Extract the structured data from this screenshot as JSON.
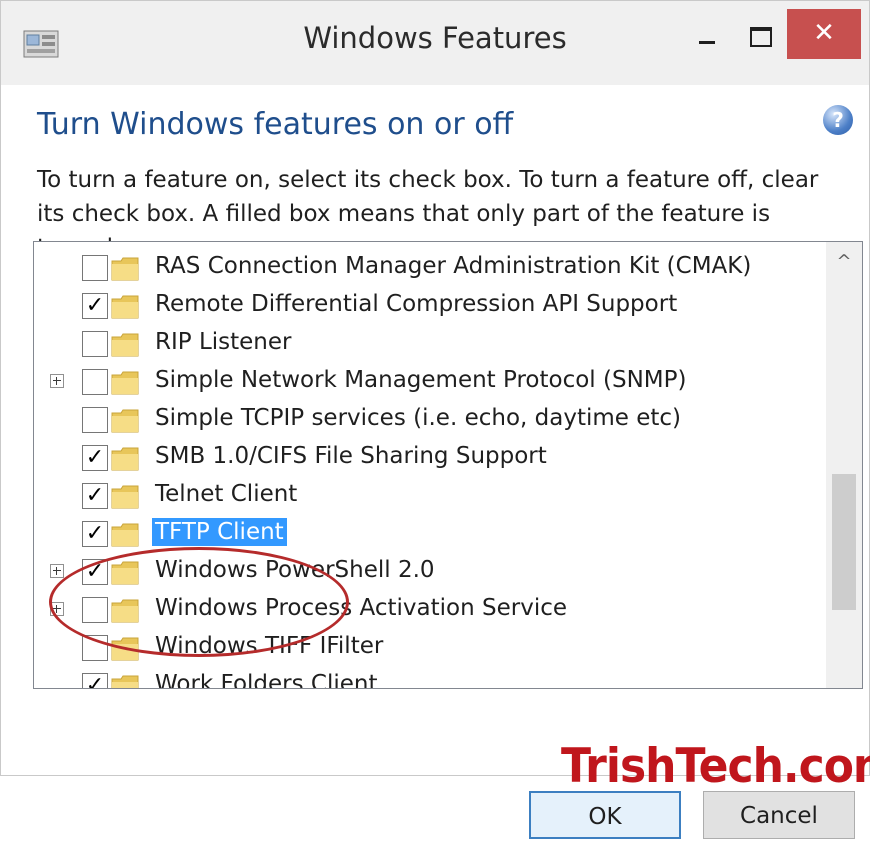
{
  "window": {
    "title": "Windows Features",
    "close_glyph": "✕"
  },
  "header": {
    "heading": "Turn Windows features on or off",
    "help_glyph": "?",
    "description": "To turn a feature on, select its check box. To turn a feature off, clear its check box. A filled box means that only part of the feature is turned on."
  },
  "features": [
    {
      "label": "RAS Connection Manager Administration Kit (CMAK)",
      "checked": false,
      "expandable": false,
      "selected": false
    },
    {
      "label": "Remote Differential Compression API Support",
      "checked": true,
      "expandable": false,
      "selected": false
    },
    {
      "label": "RIP Listener",
      "checked": false,
      "expandable": false,
      "selected": false
    },
    {
      "label": "Simple Network Management Protocol (SNMP)",
      "checked": false,
      "expandable": true,
      "selected": false
    },
    {
      "label": "Simple TCPIP services (i.e. echo, daytime etc)",
      "checked": false,
      "expandable": false,
      "selected": false
    },
    {
      "label": "SMB 1.0/CIFS File Sharing Support",
      "checked": true,
      "expandable": false,
      "selected": false
    },
    {
      "label": "Telnet Client",
      "checked": true,
      "expandable": false,
      "selected": false
    },
    {
      "label": "TFTP Client",
      "checked": true,
      "expandable": false,
      "selected": true
    },
    {
      "label": "Windows PowerShell 2.0",
      "checked": true,
      "expandable": true,
      "selected": false
    },
    {
      "label": "Windows Process Activation Service",
      "checked": false,
      "expandable": true,
      "selected": false
    },
    {
      "label": "Windows TIFF IFilter",
      "checked": false,
      "expandable": false,
      "selected": false
    },
    {
      "label": "Work Folders Client",
      "checked": true,
      "expandable": false,
      "selected": false
    }
  ],
  "scrollbar": {
    "up_glyph": "^"
  },
  "buttons": {
    "ok": "OK",
    "cancel": "Cancel"
  },
  "watermark": "TrishTech.com",
  "colors": {
    "heading": "#1f4e8c",
    "selection": "#3399ff",
    "close": "#c7504f",
    "watermark": "#c0161c",
    "highlight": "#b52b2b"
  }
}
